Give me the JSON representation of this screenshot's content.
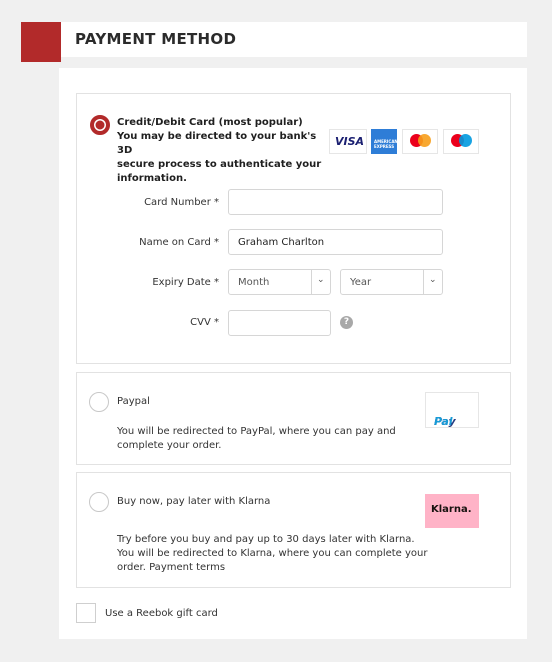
{
  "header": {
    "title": "PAYMENT METHOD"
  },
  "credit": {
    "title_lines": [
      "Credit/Debit Card (most popular)",
      "You may be directed to your bank's 3D",
      "secure process to authenticate your",
      "information."
    ],
    "logos": {
      "visa": "VISA",
      "amex": "AMERICAN EXPRESS"
    },
    "fields": {
      "card_number_label": "Card Number *",
      "card_number_value": "",
      "name_label": "Name on Card *",
      "name_value": "Graham Charlton",
      "expiry_label": "Expiry Date *",
      "month_value": "Month",
      "year_value": "Year",
      "cvv_label": "CVV *",
      "cvv_value": "",
      "help_glyph": "?"
    }
  },
  "paypal": {
    "title": "Paypal",
    "desc_lines": [
      "You will be redirected to PayPal, where you can pay and",
      "complete your order."
    ],
    "logo_a": "Pay",
    "logo_b": "Pal"
  },
  "klarna": {
    "title": "Buy now, pay later with Klarna",
    "desc_lines": [
      "Try before you buy and pay up to 30 days later with Klarna.",
      "You will be redirected to Klarna, where you can complete your",
      "order. Payment terms"
    ],
    "logo": "Klarna."
  },
  "gift_card": {
    "label": "Use a Reebok gift card"
  },
  "colors": {
    "accent": "#b22a2a",
    "klarna_pink": "#ffb3c7",
    "paypal_dark": "#253b80",
    "paypal_light": "#179bd7",
    "visa_blue": "#1a1f71",
    "amex_blue": "#2e7dd7",
    "mc_red": "#eb001b",
    "mc_orange": "#f79e1b",
    "maestro_blue": "#0099df"
  },
  "icons": [
    "radio-checked-icon",
    "radio-empty-icon",
    "visa-logo",
    "amex-logo",
    "mastercard-logo",
    "maestro-logo",
    "chevron-down-icon",
    "help-icon",
    "paypal-logo",
    "klarna-logo",
    "checkbox"
  ]
}
